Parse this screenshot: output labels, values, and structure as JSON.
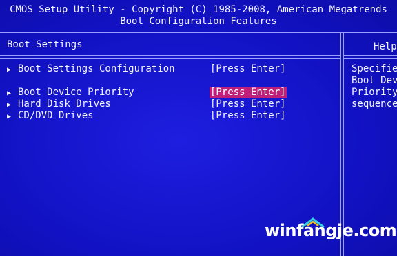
{
  "header": {
    "title": "CMOS Setup Utility - Copyright (C) 1985-2008, American Megatrends",
    "subtitle": "Boot Configuration Features"
  },
  "section_title": "Boot Settings",
  "menu_items": [
    {
      "label": "Boot Settings Configuration",
      "value": "[Press Enter]",
      "icon": "triangle-right-icon"
    },
    {
      "label": "Boot Device Priority",
      "value": "[Press Enter]",
      "icon": "triangle-right-icon",
      "selected": true
    },
    {
      "label": "Hard Disk Drives",
      "value": "[Press Enter]",
      "icon": "triangle-right-icon"
    },
    {
      "label": "CD/DVD Drives",
      "value": "[Press Enter]",
      "icon": "triangle-right-icon"
    }
  ],
  "help_panel": {
    "title": "Help",
    "lines": [
      "Specifie",
      "Boot Dev",
      "Priority",
      "sequence"
    ]
  },
  "watermark": "winfangje.com",
  "colors": {
    "background": "#1414c8",
    "text": "#f4f4ff",
    "separator": "#9aa0ff",
    "highlight": "#c0207a"
  }
}
